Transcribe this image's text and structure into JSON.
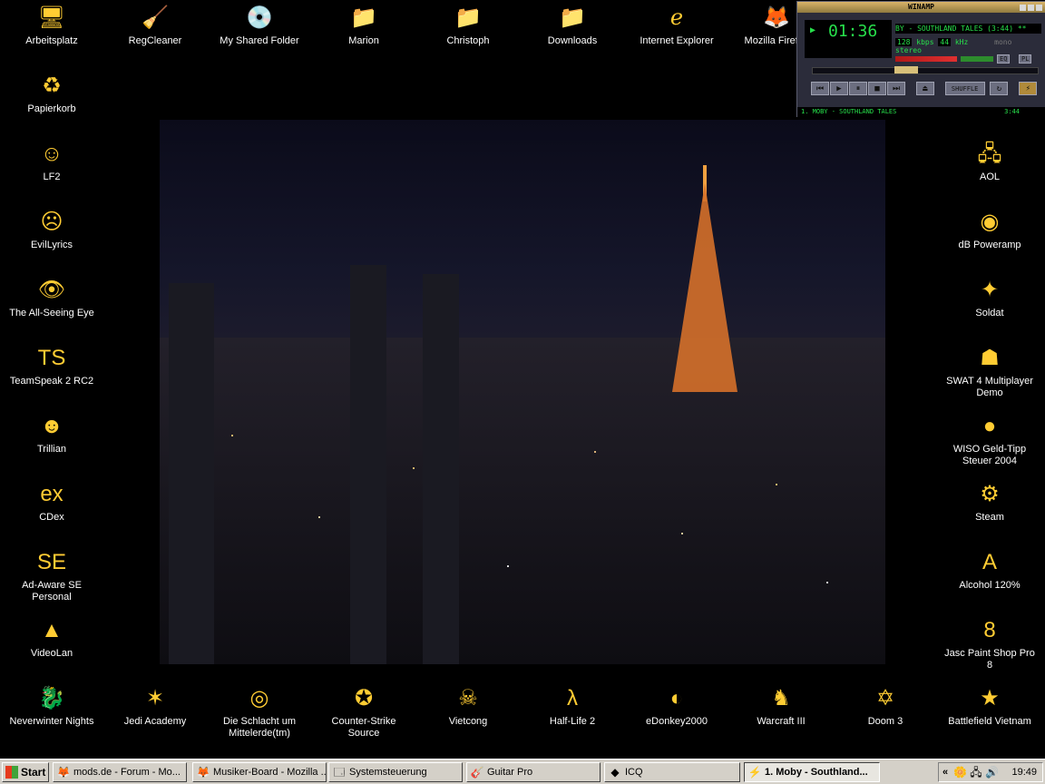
{
  "desktop": {
    "icons_top": [
      {
        "label": "Arbeitsplatz",
        "icon": "🖥"
      },
      {
        "label": "RegCleaner",
        "icon": "🧹"
      },
      {
        "label": "My Shared Folder",
        "icon": "💿"
      },
      {
        "label": "Marion",
        "icon": "📁"
      },
      {
        "label": "Christoph",
        "icon": "📁"
      },
      {
        "label": "Downloads",
        "icon": "📁"
      },
      {
        "label": "Internet Explorer",
        "icon": "ℯ"
      },
      {
        "label": "Mozilla Firefox",
        "icon": "🦊"
      }
    ],
    "icons_left": [
      {
        "label": "Papierkorb",
        "icon": "♻"
      },
      {
        "label": "LF2",
        "icon": "☺"
      },
      {
        "label": "EvilLyrics",
        "icon": "☹"
      },
      {
        "label": "The All-Seeing Eye",
        "icon": "👁"
      },
      {
        "label": "TeamSpeak 2 RC2",
        "icon": "TS"
      },
      {
        "label": "Trillian",
        "icon": "☻"
      },
      {
        "label": "CDex",
        "icon": "ex"
      },
      {
        "label": "Ad-Aware SE Personal",
        "icon": "SE"
      },
      {
        "label": "VideoLan",
        "icon": "▲"
      }
    ],
    "icons_right": [
      {
        "label": "AOL",
        "icon": "🖧"
      },
      {
        "label": "dB Poweramp",
        "icon": "◉"
      },
      {
        "label": "Soldat",
        "icon": "✦"
      },
      {
        "label": "SWAT 4 Multiplayer Demo",
        "icon": "☗"
      },
      {
        "label": "WISO Geld-Tipp Steuer 2004",
        "icon": "●"
      },
      {
        "label": "Steam",
        "icon": "⚙"
      },
      {
        "label": "Alcohol 120%",
        "icon": "A"
      },
      {
        "label": "Jasc Paint Shop Pro 8",
        "icon": "8"
      },
      {
        "label": "Battlefield Vietnam",
        "icon": "★"
      }
    ],
    "icons_bottom": [
      {
        "label": "Neverwinter Nights",
        "icon": "🐉"
      },
      {
        "label": "Jedi Academy",
        "icon": "✶"
      },
      {
        "label": "Die Schlacht um Mittelerde(tm)",
        "icon": "◎"
      },
      {
        "label": "Counter-Strike Source",
        "icon": "✪"
      },
      {
        "label": "Vietcong",
        "icon": "☠"
      },
      {
        "label": "Half-Life 2",
        "icon": "λ"
      },
      {
        "label": "eDonkey2000",
        "icon": "◐"
      },
      {
        "label": "Warcraft III",
        "icon": "♞"
      },
      {
        "label": "Doom 3",
        "icon": "✡"
      }
    ]
  },
  "winamp": {
    "title": "WINAMP",
    "time": "01:36",
    "marquee": "BY - SOUTHLAND TALES (3:44) **",
    "kbps": "128",
    "kbps_label": "kbps",
    "khz": "44",
    "khz_label": "kHz",
    "mono": "mono",
    "stereo": "stereo",
    "eq": "EQ",
    "pl": "PL",
    "shuffle": "SHUFFLE",
    "playlist_entry": "1. MOBY - SOUTHLAND TALES",
    "playlist_len": "3:44"
  },
  "taskbar": {
    "start": "Start",
    "tasks": [
      {
        "label": "mods.de - Forum - Mo...",
        "icon": "🦊",
        "active": false
      },
      {
        "label": "Musiker-Board - Mozilla ...",
        "icon": "🦊",
        "active": false
      },
      {
        "label": "Systemsteuerung",
        "icon": "🗔",
        "active": false
      },
      {
        "label": "Guitar Pro",
        "icon": "🎸",
        "active": false
      },
      {
        "label": "ICQ",
        "icon": "◆",
        "active": false
      },
      {
        "label": "1. Moby - Southland...",
        "icon": "⚡",
        "active": true
      }
    ],
    "tray_chevron": "«",
    "clock": "19:49"
  }
}
